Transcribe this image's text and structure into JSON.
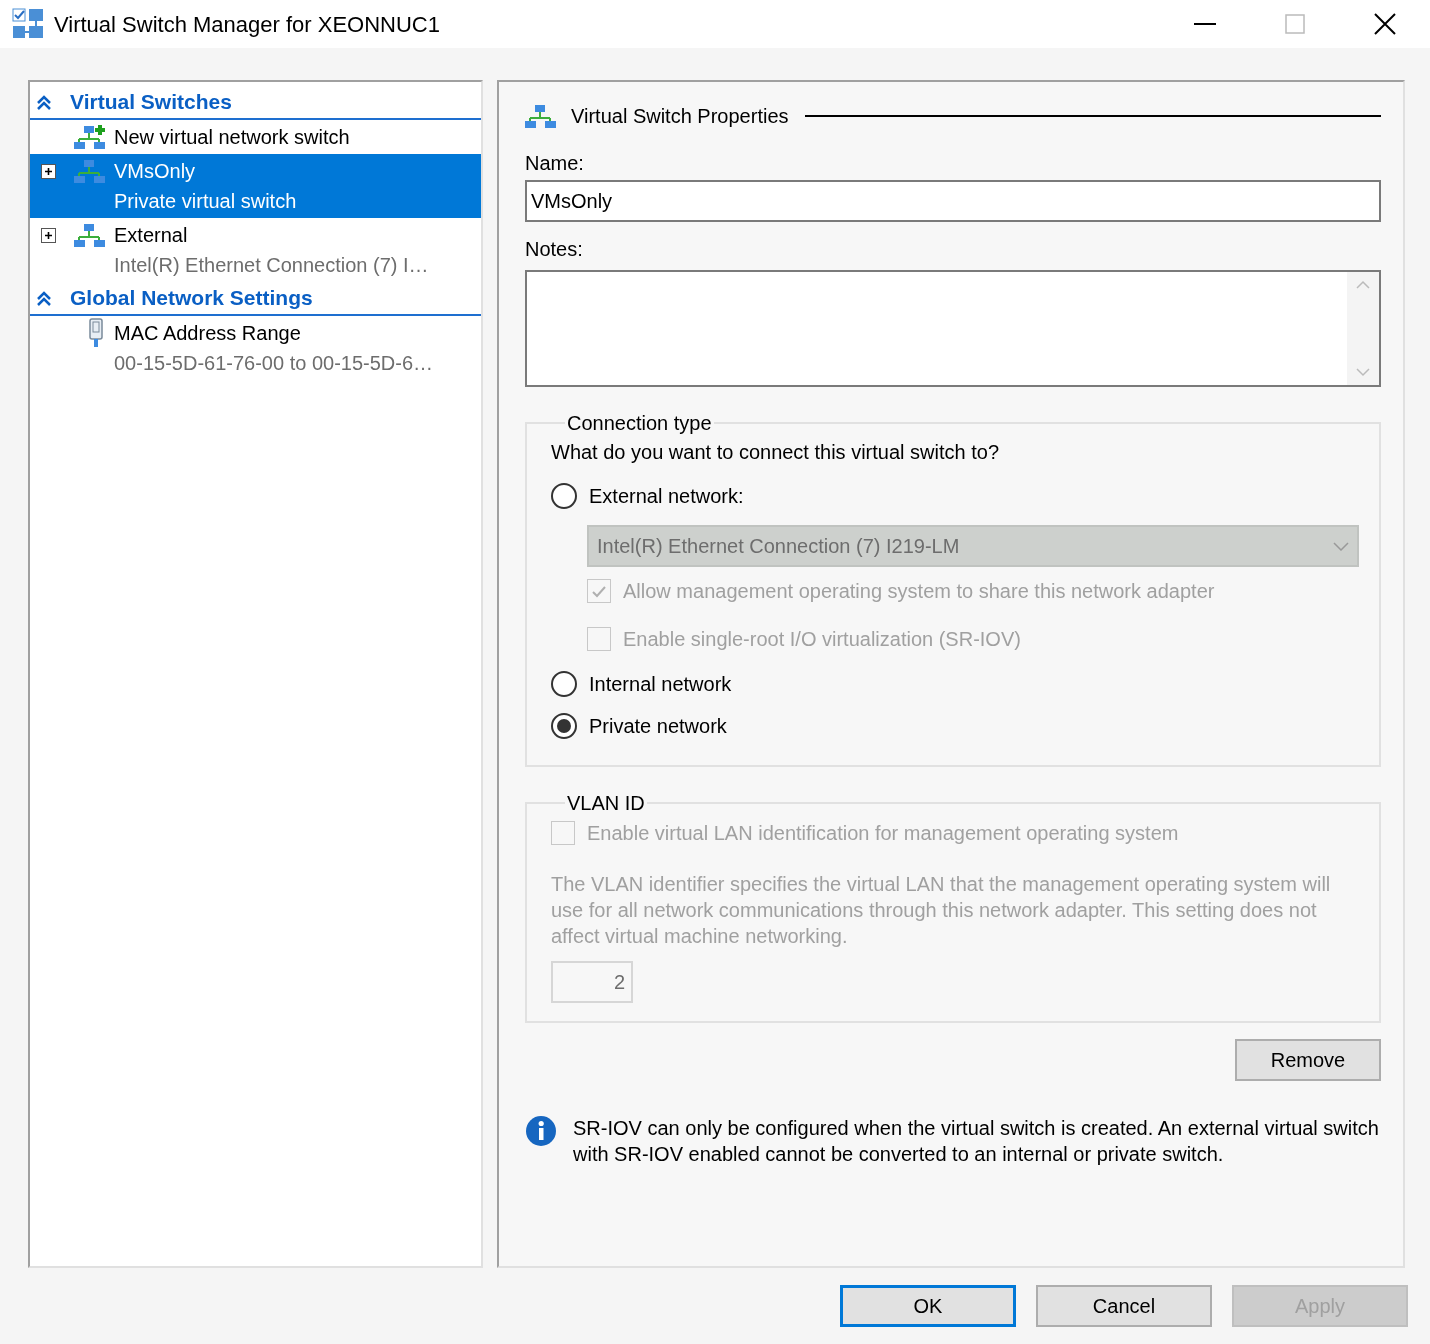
{
  "window": {
    "title": "Virtual Switch Manager for XEONNUC1"
  },
  "sidebar": {
    "sections": [
      {
        "title": "Virtual Switches",
        "items": [
          {
            "kind": "new",
            "label": "New virtual network switch",
            "selected": false
          },
          {
            "kind": "switch",
            "label": "VMsOnly",
            "detail": "Private virtual switch",
            "selected": true
          },
          {
            "kind": "switch",
            "label": "External",
            "detail": "Intel(R) Ethernet Connection (7) I…",
            "selected": false
          }
        ]
      },
      {
        "title": "Global Network Settings",
        "items": [
          {
            "kind": "mac",
            "label": "MAC Address Range",
            "detail": "00-15-5D-61-76-00 to 00-15-5D-6…",
            "selected": false
          }
        ]
      }
    ]
  },
  "properties": {
    "heading": "Virtual Switch Properties",
    "name_label": "Name:",
    "name_value": "VMsOnly",
    "notes_label": "Notes:",
    "connection_type": {
      "legend": "Connection type",
      "question": "What do you want to connect this virtual switch to?",
      "options": [
        {
          "label": "External network:",
          "selected": false,
          "adapter": {
            "value": "Intel(R) Ethernet Connection (7) I219-LM",
            "disabled": true
          },
          "checkboxes": [
            {
              "label": "Allow management operating system to share this network adapter",
              "checked": true,
              "disabled": true
            },
            {
              "label": "Enable single-root I/O virtualization (SR-IOV)",
              "checked": false,
              "disabled": true
            }
          ]
        },
        {
          "label": "Internal network",
          "selected": false
        },
        {
          "label": "Private network",
          "selected": true
        }
      ]
    },
    "vlan": {
      "legend": "VLAN ID",
      "checkbox": {
        "label": "Enable virtual LAN identification for management operating system",
        "checked": false,
        "disabled": true
      },
      "description": "The VLAN identifier specifies the virtual LAN that the management operating system will use for all network communications through this network adapter. This setting does not affect virtual machine networking.",
      "vlan_id": {
        "value": "2",
        "disabled": true
      }
    },
    "remove_button": "Remove",
    "info": "SR-IOV can only be configured when the virtual switch is created. An external virtual switch with SR-IOV enabled cannot be converted to an internal or private switch."
  },
  "buttons": [
    {
      "label": "OK",
      "kind": "default",
      "disabled": false
    },
    {
      "label": "Cancel",
      "kind": "normal",
      "disabled": false
    },
    {
      "label": "Apply",
      "kind": "normal",
      "disabled": true
    }
  ]
}
